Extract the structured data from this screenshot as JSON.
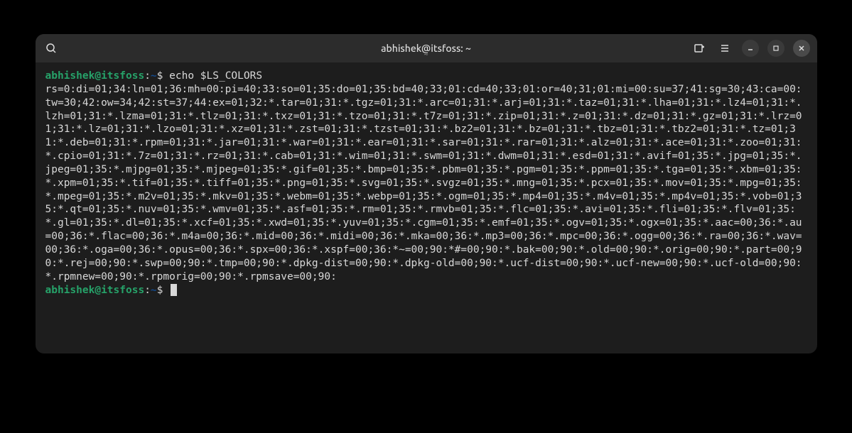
{
  "titlebar": {
    "title": "abhishek@itsfoss: ~",
    "subtitle": "~"
  },
  "prompt": {
    "user": "abhishek",
    "at": "@",
    "host": "itsfoss",
    "colon": ":",
    "path": "~",
    "dollar": "$"
  },
  "command": "echo $LS_COLORS",
  "output": "rs=0:di=01;34:ln=01;36:mh=00:pi=40;33:so=01;35:do=01;35:bd=40;33;01:cd=40;33;01:or=40;31;01:mi=00:su=37;41:sg=30;43:ca=00:tw=30;42:ow=34;42:st=37;44:ex=01;32:*.tar=01;31:*.tgz=01;31:*.arc=01;31:*.arj=01;31:*.taz=01;31:*.lha=01;31:*.lz4=01;31:*.lzh=01;31:*.lzma=01;31:*.tlz=01;31:*.txz=01;31:*.tzo=01;31:*.t7z=01;31:*.zip=01;31:*.z=01;31:*.dz=01;31:*.gz=01;31:*.lrz=01;31:*.lz=01;31:*.lzo=01;31:*.xz=01;31:*.zst=01;31:*.tzst=01;31:*.bz2=01;31:*.bz=01;31:*.tbz=01;31:*.tbz2=01;31:*.tz=01;31:*.deb=01;31:*.rpm=01;31:*.jar=01;31:*.war=01;31:*.ear=01;31:*.sar=01;31:*.rar=01;31:*.alz=01;31:*.ace=01;31:*.zoo=01;31:*.cpio=01;31:*.7z=01;31:*.rz=01;31:*.cab=01;31:*.wim=01;31:*.swm=01;31:*.dwm=01;31:*.esd=01;31:*.avif=01;35:*.jpg=01;35:*.jpeg=01;35:*.mjpg=01;35:*.mjpeg=01;35:*.gif=01;35:*.bmp=01;35:*.pbm=01;35:*.pgm=01;35:*.ppm=01;35:*.tga=01;35:*.xbm=01;35:*.xpm=01;35:*.tif=01;35:*.tiff=01;35:*.png=01;35:*.svg=01;35:*.svgz=01;35:*.mng=01;35:*.pcx=01;35:*.mov=01;35:*.mpg=01;35:*.mpeg=01;35:*.m2v=01;35:*.mkv=01;35:*.webm=01;35:*.webp=01;35:*.ogm=01;35:*.mp4=01;35:*.m4v=01;35:*.mp4v=01;35:*.vob=01;35:*.qt=01;35:*.nuv=01;35:*.wmv=01;35:*.asf=01;35:*.rm=01;35:*.rmvb=01;35:*.flc=01;35:*.avi=01;35:*.fli=01;35:*.flv=01;35:*.gl=01;35:*.dl=01;35:*.xcf=01;35:*.xwd=01;35:*.yuv=01;35:*.cgm=01;35:*.emf=01;35:*.ogv=01;35:*.ogx=01;35:*.aac=00;36:*.au=00;36:*.flac=00;36:*.m4a=00;36:*.mid=00;36:*.midi=00;36:*.mka=00;36:*.mp3=00;36:*.mpc=00;36:*.ogg=00;36:*.ra=00;36:*.wav=00;36:*.oga=00;36:*.opus=00;36:*.spx=00;36:*.xspf=00;36:*~=00;90:*#=00;90:*.bak=00;90:*.old=00;90:*.orig=00;90:*.part=00;90:*.rej=00;90:*.swp=00;90:*.tmp=00;90:*.dpkg-dist=00;90:*.dpkg-old=00;90:*.ucf-dist=00;90:*.ucf-new=00;90:*.ucf-old=00;90:*.rpmnew=00;90:*.rpmorig=00;90:*.rpmsave=00;90:"
}
